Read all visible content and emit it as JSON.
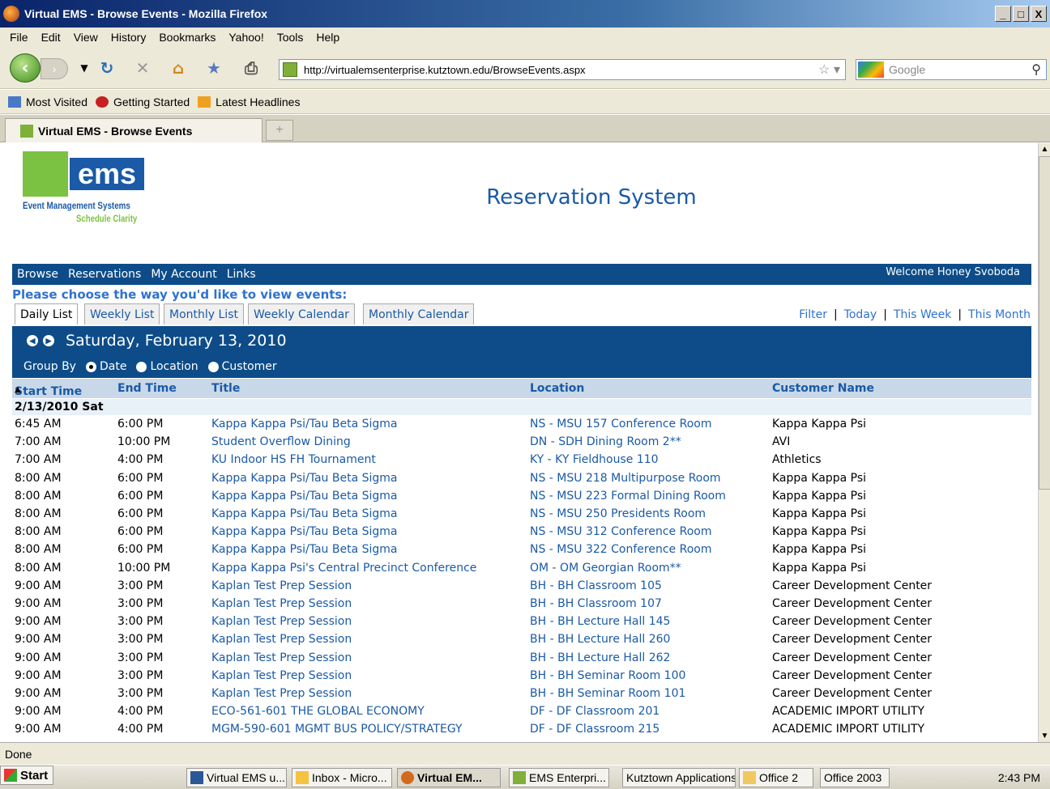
{
  "window": {
    "title": "Virtual EMS - Browse Events - Mozilla Firefox",
    "minimize": "_",
    "restore": "□",
    "close": "X"
  },
  "menu": [
    "File",
    "Edit",
    "View",
    "History",
    "Bookmarks",
    "Yahoo!",
    "Tools",
    "Help"
  ],
  "nav": {
    "url": "http://virtualemsenterprise.kutztown.edu/BrowseEvents.aspx",
    "search_placeholder": "Google"
  },
  "bookmarks": [
    "Most Visited",
    "Getting Started",
    "Latest Headlines"
  ],
  "tab": {
    "title": "Virtual EMS - Browse Events",
    "new_tab": "+"
  },
  "page": {
    "logo": {
      "mark": "ems",
      "line1": "Event Management Systems",
      "line2": "Schedule Clarity"
    },
    "title": "Reservation System",
    "main_nav": [
      "Browse",
      "Reservations",
      "My Account",
      "Links"
    ],
    "welcome": "Welcome Honey Svoboda",
    "prompt": "Please choose the way you'd like to view events:",
    "view_tabs": [
      "Daily List",
      "Weekly List",
      "Monthly List",
      "Weekly Calendar",
      "Monthly Calendar"
    ],
    "right_links": [
      "Filter",
      "Today",
      "This Week",
      "This Month"
    ],
    "date": "Saturday, February 13, 2010",
    "group_by": {
      "label": "Group By",
      "options": [
        "Date",
        "Location",
        "Customer"
      ],
      "selected": "Date"
    },
    "columns": [
      "Start Time",
      "End Time",
      "Title",
      "Location",
      "Customer Name"
    ],
    "sort_indicator": "▲",
    "group_label": "2/13/2010 Sat",
    "rows": [
      [
        "6:45 AM",
        "6:00 PM",
        "Kappa Kappa Psi/Tau Beta Sigma",
        "NS - MSU 157 Conference Room",
        "Kappa Kappa Psi"
      ],
      [
        "7:00 AM",
        "10:00 PM",
        "Student Overflow Dining",
        "DN - SDH Dining Room 2**",
        "AVI"
      ],
      [
        "7:00 AM",
        "4:00 PM",
        "KU Indoor HS FH Tournament",
        "KY - KY Fieldhouse 110",
        "Athletics"
      ],
      [
        "8:00 AM",
        "6:00 PM",
        "Kappa Kappa Psi/Tau Beta Sigma",
        "NS - MSU 218 Multipurpose Room",
        "Kappa Kappa Psi"
      ],
      [
        "8:00 AM",
        "6:00 PM",
        "Kappa Kappa Psi/Tau Beta Sigma",
        "NS - MSU 223 Formal Dining Room",
        "Kappa Kappa Psi"
      ],
      [
        "8:00 AM",
        "6:00 PM",
        "Kappa Kappa Psi/Tau Beta Sigma",
        "NS - MSU 250 Presidents Room",
        "Kappa Kappa Psi"
      ],
      [
        "8:00 AM",
        "6:00 PM",
        "Kappa Kappa Psi/Tau Beta Sigma",
        "NS - MSU 312 Conference Room",
        "Kappa Kappa Psi"
      ],
      [
        "8:00 AM",
        "6:00 PM",
        "Kappa Kappa Psi/Tau Beta Sigma",
        "NS - MSU 322 Conference Room",
        "Kappa Kappa Psi"
      ],
      [
        "8:00 AM",
        "10:00 PM",
        "Kappa Kappa Psi's Central Precinct Conference",
        "OM - OM Georgian Room**",
        "Kappa Kappa Psi"
      ],
      [
        "9:00 AM",
        "3:00 PM",
        "Kaplan Test Prep Session",
        "BH - BH Classroom 105",
        "Career Development Center"
      ],
      [
        "9:00 AM",
        "3:00 PM",
        "Kaplan Test Prep Session",
        "BH - BH Classroom 107",
        "Career Development Center"
      ],
      [
        "9:00 AM",
        "3:00 PM",
        "Kaplan Test Prep Session",
        "BH - BH Lecture Hall 145",
        "Career Development Center"
      ],
      [
        "9:00 AM",
        "3:00 PM",
        "Kaplan Test Prep Session",
        "BH - BH Lecture Hall 260",
        "Career Development Center"
      ],
      [
        "9:00 AM",
        "3:00 PM",
        "Kaplan Test Prep Session",
        "BH - BH Lecture Hall 262",
        "Career Development Center"
      ],
      [
        "9:00 AM",
        "3:00 PM",
        "Kaplan Test Prep Session",
        "BH - BH Seminar Room 100",
        "Career Development Center"
      ],
      [
        "9:00 AM",
        "3:00 PM",
        "Kaplan Test Prep Session",
        "BH - BH Seminar Room 101",
        "Career Development Center"
      ],
      [
        "9:00 AM",
        "4:00 PM",
        "ECO-561-601 THE GLOBAL ECONOMY",
        "DF - DF Classroom 201",
        "ACADEMIC IMPORT UTILITY"
      ],
      [
        "9:00 AM",
        "4:00 PM",
        "MGM-590-601 MGMT BUS POLICY/STRATEGY",
        "DF - DF Classroom 215",
        "ACADEMIC IMPORT UTILITY"
      ]
    ]
  },
  "status": "Done",
  "taskbar": {
    "start": "Start",
    "items": [
      "Virtual EMS u...",
      "Inbox - Micro...",
      "Virtual EM...",
      "EMS Enterpri...",
      "Kutztown Applications",
      "Office 2",
      "Office 2003"
    ],
    "clock": "2:43 PM"
  }
}
